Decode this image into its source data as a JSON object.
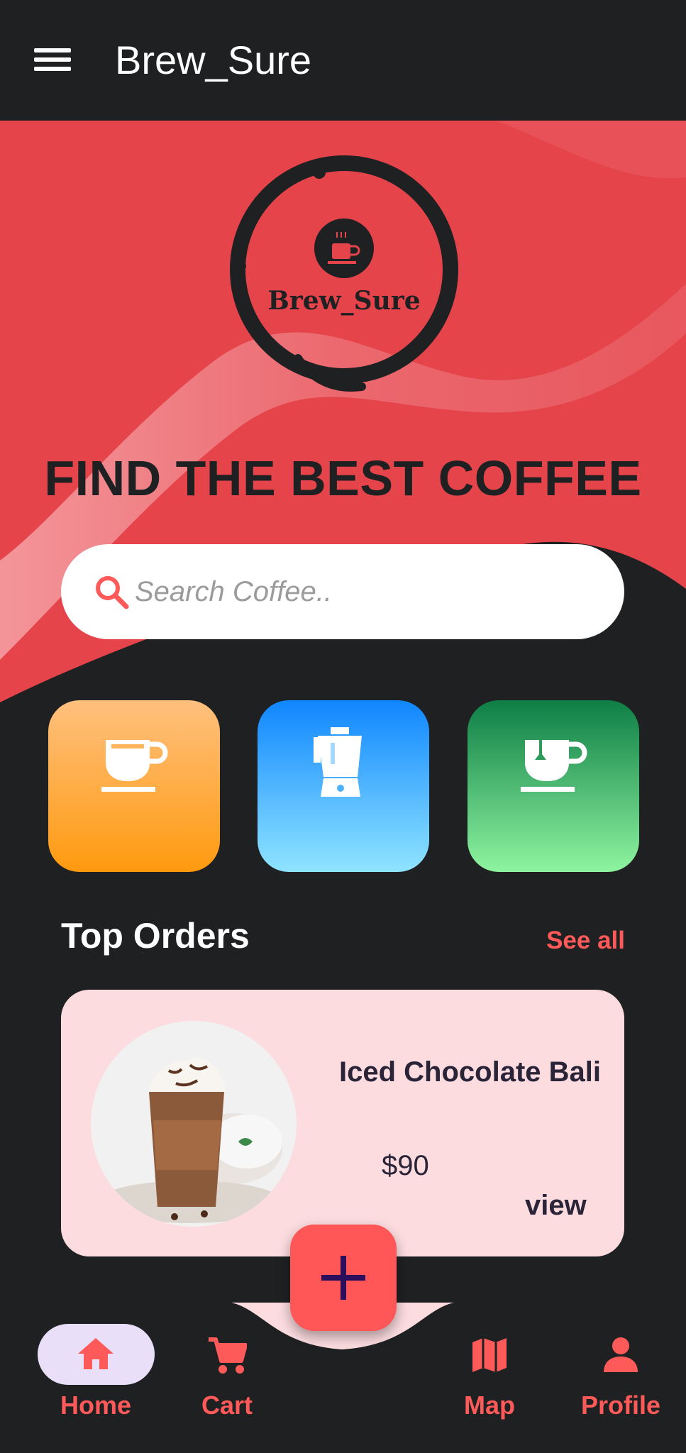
{
  "app_bar": {
    "title": "Brew_Sure"
  },
  "logo": {
    "text": "Brew_Sure"
  },
  "hero": {
    "headline": "FIND THE BEST COFFEE"
  },
  "search": {
    "placeholder": "Search Coffee..",
    "value": ""
  },
  "categories": [
    {
      "icon": "coffee-cup-icon",
      "color_top": "#ffc07e",
      "color_bottom": "#ff9a0f"
    },
    {
      "icon": "blender-icon",
      "color_top": "#0f86ff",
      "color_bottom": "#8fe4ff"
    },
    {
      "icon": "tea-cup-icon",
      "color_top": "#0e7e45",
      "color_bottom": "#8ef4a0"
    }
  ],
  "top_orders": {
    "title": "Top Orders",
    "see_all": "See all",
    "items": [
      {
        "name": "Iced Chocolate Bali",
        "price": "$90",
        "action": "view"
      }
    ]
  },
  "fab": {
    "icon": "plus-icon"
  },
  "bottom_nav": {
    "items": [
      {
        "label": "Home",
        "icon": "home-icon",
        "active": true
      },
      {
        "label": "Cart",
        "icon": "cart-icon",
        "active": false
      },
      {
        "label": "Map",
        "icon": "map-icon",
        "active": false
      },
      {
        "label": "Profile",
        "icon": "person-icon",
        "active": false
      }
    ]
  },
  "colors": {
    "background": "#1e2022",
    "accent": "#ff5a5a",
    "hero_red": "#e5444b",
    "card": "#fcdcdf",
    "active_pill": "#e9dff8"
  }
}
